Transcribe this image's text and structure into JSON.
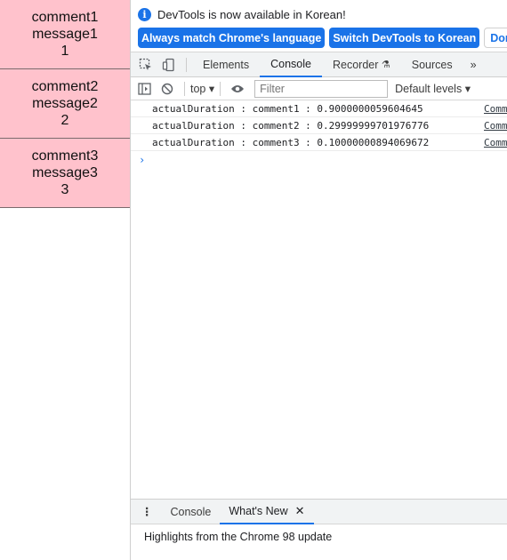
{
  "page": {
    "comments": [
      {
        "name": "comment1",
        "message": "message1",
        "id": "1"
      },
      {
        "name": "comment2",
        "message": "message2",
        "id": "2"
      },
      {
        "name": "comment3",
        "message": "message3",
        "id": "3"
      }
    ]
  },
  "infobar": {
    "text": "DevTools is now available in Korean!",
    "btn_match": "Always match Chrome's language",
    "btn_switch": "Switch DevTools to Korean",
    "btn_dont": "Don't show again"
  },
  "tabs": {
    "elements": "Elements",
    "console": "Console",
    "recorder": "Recorder",
    "sources": "Sources",
    "more": "»"
  },
  "toolbar": {
    "context": "top",
    "filter_placeholder": "Filter",
    "levels": "Default levels"
  },
  "console_messages": [
    {
      "text": "actualDuration : comment1 : 0.9000000059604645",
      "source": "Comment.js"
    },
    {
      "text": "actualDuration : comment2 : 0.29999999701976776",
      "source": "Comment.js"
    },
    {
      "text": "actualDuration : comment3 : 0.10000000894069672",
      "source": "Comment.js"
    }
  ],
  "drawer": {
    "tab_console": "Console",
    "tab_whats_new": "What's New",
    "body": "Highlights from the Chrome 98 update"
  }
}
